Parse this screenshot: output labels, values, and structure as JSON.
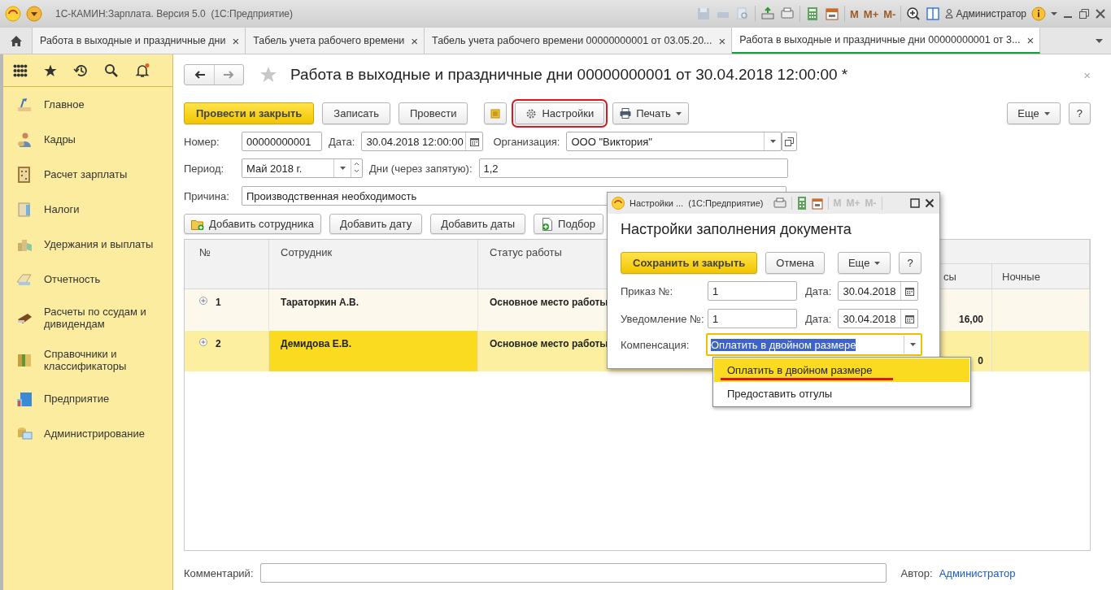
{
  "window": {
    "title": "1С-КАМИН:Зарплата. Версия 5.0  (1С:Предприятие)",
    "memory_buttons": [
      "М",
      "М+",
      "М-"
    ],
    "user": "Администратор"
  },
  "tabs": [
    {
      "label": "Работа в выходные и праздничные дни",
      "close": "×",
      "selected": false
    },
    {
      "label": "Табель учета рабочего времени",
      "close": "×",
      "selected": false
    },
    {
      "label": "Табель учета рабочего времени 00000000001 от 03.05.20...",
      "close": "×",
      "selected": false
    },
    {
      "label": "Работа в выходные и праздничные дни 00000000001 от 3...",
      "close": "×",
      "selected": true
    }
  ],
  "sidebar": {
    "items": [
      {
        "label": "Главное"
      },
      {
        "label": "Кадры"
      },
      {
        "label": "Расчет зарплаты"
      },
      {
        "label": "Налоги"
      },
      {
        "label": "Удержания и выплаты"
      },
      {
        "label": "Отчетность"
      },
      {
        "label": "Расчеты по ссудам и дивидендам"
      },
      {
        "label": "Справочники и классификаторы"
      },
      {
        "label": "Предприятие"
      },
      {
        "label": "Администрирование"
      }
    ]
  },
  "document": {
    "title": "Работа в выходные и праздничные дни 00000000001 от 30.04.2018 12:00:00 *",
    "close": "×",
    "buttons": [
      {
        "label": "Провести и закрыть",
        "kind": "default",
        "marked": false
      },
      {
        "label": "Записать",
        "kind": "plain",
        "marked": false
      },
      {
        "label": "Провести",
        "kind": "plain",
        "marked": false
      },
      {
        "kind": "icon",
        "marked": false
      },
      {
        "label": "Настройки",
        "kind": "settings",
        "marked": true
      },
      {
        "label": "Печать",
        "kind": "print",
        "marked": false
      }
    ],
    "more": "Еще",
    "help": "?",
    "number": {
      "label": "Номер:",
      "value": "00000000001"
    },
    "date": {
      "label": "Дата:",
      "value": "30.04.2018 12:00:00"
    },
    "organization": {
      "label": "Организация:",
      "value": "ООО \"Виктория\""
    },
    "period": {
      "label": "Период:",
      "value": "Май 2018 г."
    },
    "days": {
      "label": "Дни (через запятую):",
      "value": "1,2"
    },
    "reason": {
      "label": "Причина:",
      "value": "Производственная необходимость"
    }
  },
  "table": {
    "toolbar": [
      {
        "label": "Добавить сотрудника",
        "kind": "folder"
      },
      {
        "label": "Добавить дату",
        "kind": "plain"
      },
      {
        "label": "Добавить даты",
        "kind": "plain"
      },
      {
        "label": "Подбор",
        "kind": "pick"
      }
    ],
    "columns": [
      "№",
      "Сотрудник",
      "Статус работы",
      "сы",
      "Ночные"
    ],
    "rows": [
      {
        "number": "1",
        "employee": "Тараторкин А.В.",
        "status": "Основное место работы",
        "hours": "16,00",
        "selected": false
      },
      {
        "number": "2",
        "employee": "Демидова Е.В.",
        "status": "Основное место работы",
        "hours": "0",
        "selected": true
      }
    ]
  },
  "comment": {
    "label": "Комментарий:"
  },
  "author": {
    "label": "Автор:",
    "value": "Администратор"
  },
  "dialog": {
    "title": "Настройки ...  (1С:Предприятие)",
    "memory_buttons": [
      "М",
      "М+",
      "М-"
    ],
    "heading": "Настройки заполнения документа",
    "buttons": [
      {
        "label": "Сохранить и закрыть",
        "kind": "default"
      },
      {
        "label": "Отмена",
        "kind": "plain"
      },
      {
        "label": "Еще",
        "kind": "menu"
      },
      {
        "label": "?",
        "kind": "plain"
      }
    ],
    "order": {
      "label": "Приказ №:",
      "value": "1",
      "date_label": "Дата:",
      "date": "30.04.2018"
    },
    "notice": {
      "label": "Уведомление №:",
      "value": "1",
      "date_label": "Дата:",
      "date": "30.04.2018"
    },
    "compensation": {
      "label": "Компенсация:",
      "value": "Оплатить в двойном размере",
      "options": [
        {
          "label": "Оплатить в двойном размере",
          "selected": true,
          "marked": true
        },
        {
          "label": "Предоставить отгулы",
          "selected": false,
          "marked": false
        }
      ]
    }
  }
}
